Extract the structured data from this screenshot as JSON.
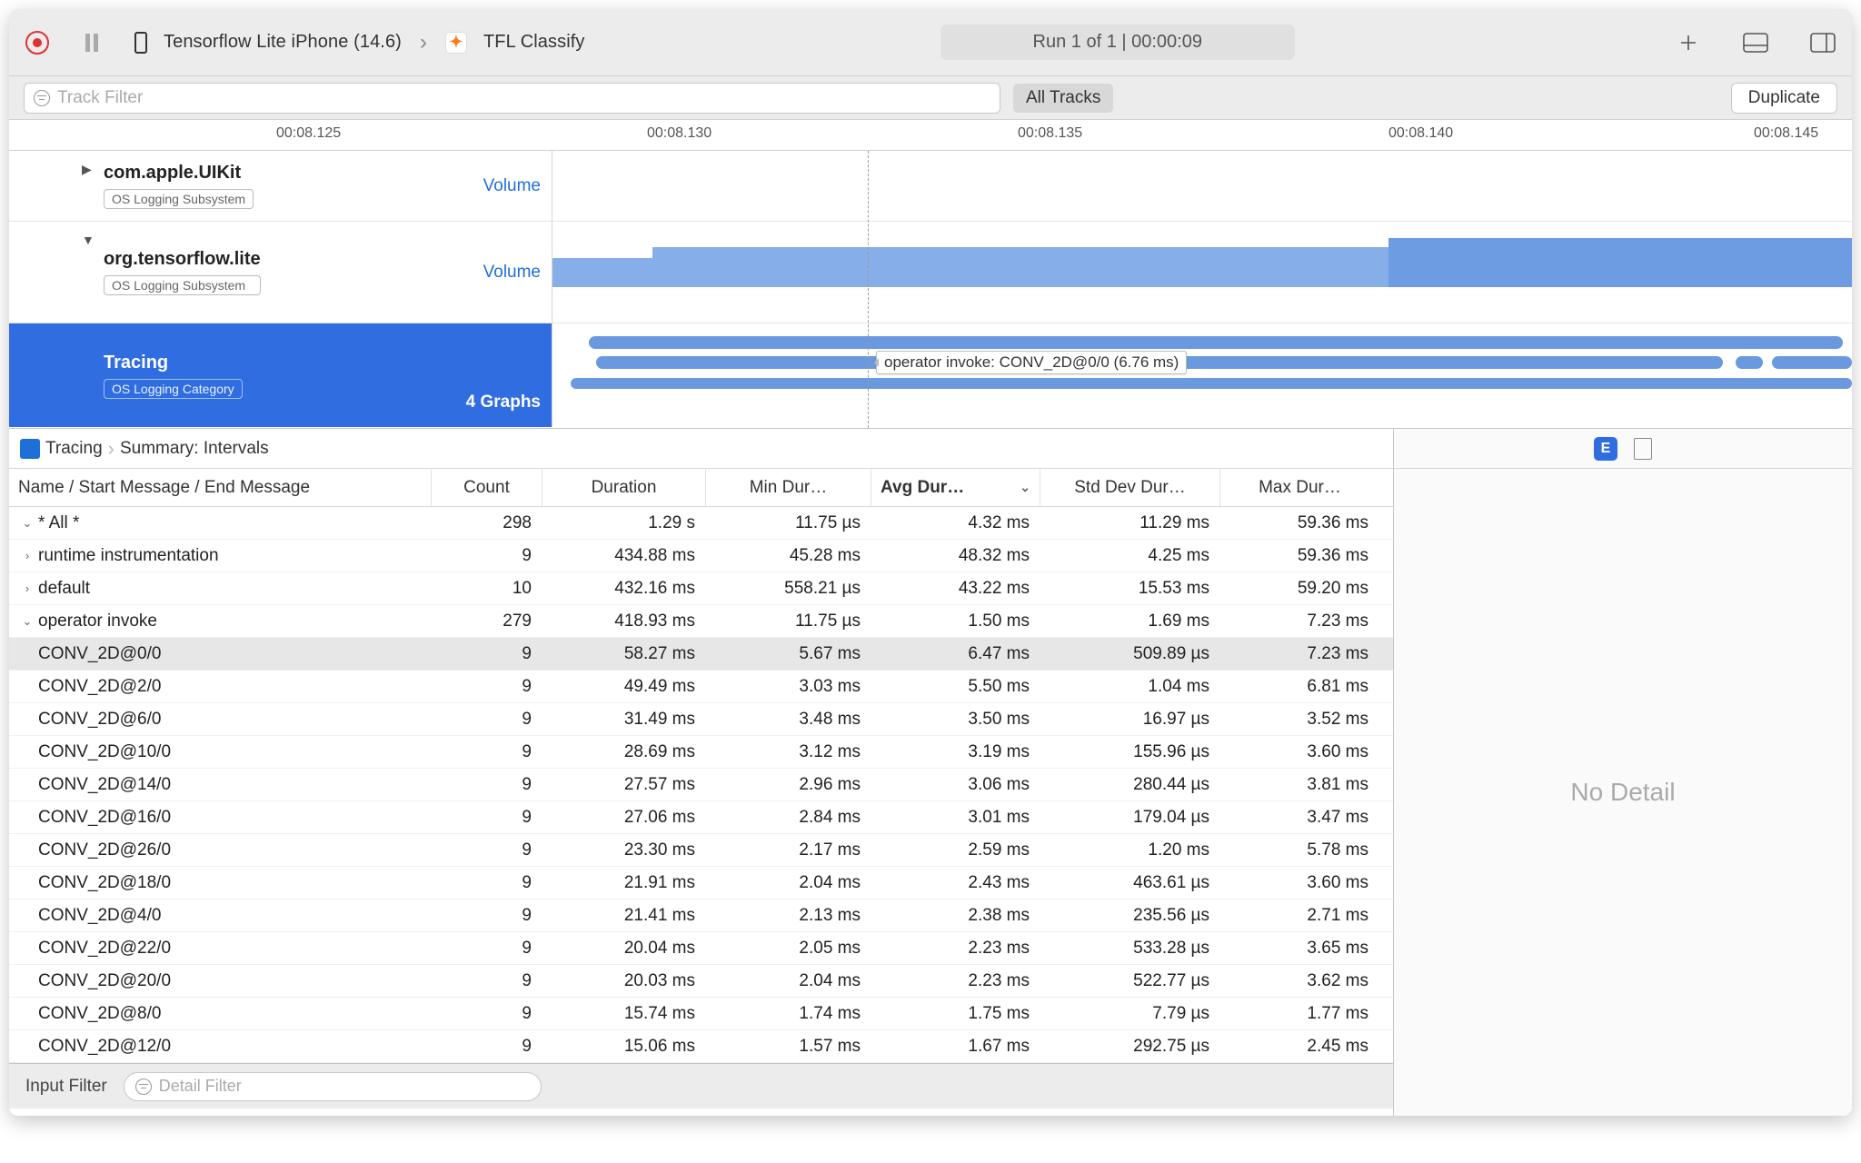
{
  "toolbar": {
    "device": "Tensorflow Lite iPhone (14.6)",
    "app": "TFL Classify",
    "run_status": "Run 1 of 1  |  00:00:09"
  },
  "filterbar": {
    "track_placeholder": "Track Filter",
    "all_tracks": "All Tracks",
    "duplicate": "Duplicate"
  },
  "ruler": {
    "ticks": [
      "00:08.125",
      "00:08.130",
      "00:08.135",
      "00:08.140",
      "00:08.145"
    ]
  },
  "tracks": {
    "uikit": {
      "title": "com.apple.UIKit",
      "subtitle": "OS Logging Subsystem",
      "mode": "Volume"
    },
    "tflite": {
      "title": "org.tensorflow.lite",
      "subtitle": "OS Logging Subsystem",
      "mode": "Volume"
    },
    "tracing": {
      "title": "Tracing",
      "subtitle": "OS Logging Category",
      "graphs": "4 Graphs",
      "tooltip": "operator invoke: CONV_2D@0/0 (6.76 ms)"
    }
  },
  "crumbs": {
    "a": "Tracing",
    "b": "Summary: Intervals"
  },
  "columns": {
    "name": "Name / Start Message / End Message",
    "count": "Count",
    "dur": "Duration",
    "min": "Min Dur…",
    "avg": "Avg Dur…",
    "std": "Std Dev Dur…",
    "max": "Max Dur…"
  },
  "rows": [
    {
      "indent": 0,
      "disc": "v",
      "name": "* All *",
      "count": "298",
      "dur": "1.29 s",
      "min": "11.75 µs",
      "avg": "4.32 ms",
      "std": "11.29 ms",
      "max": "59.36 ms",
      "sel": false
    },
    {
      "indent": 1,
      "disc": ">",
      "name": "runtime instrumentation",
      "count": "9",
      "dur": "434.88 ms",
      "min": "45.28 ms",
      "avg": "48.32 ms",
      "std": "4.25 ms",
      "max": "59.36 ms",
      "sel": false
    },
    {
      "indent": 1,
      "disc": ">",
      "name": "default",
      "count": "10",
      "dur": "432.16 ms",
      "min": "558.21 µs",
      "avg": "43.22 ms",
      "std": "15.53 ms",
      "max": "59.20 ms",
      "sel": false
    },
    {
      "indent": 1,
      "disc": "v",
      "name": "operator invoke",
      "count": "279",
      "dur": "418.93 ms",
      "min": "11.75 µs",
      "avg": "1.50 ms",
      "std": "1.69 ms",
      "max": "7.23 ms",
      "sel": false
    },
    {
      "indent": 2,
      "disc": "",
      "name": "CONV_2D@0/0",
      "count": "9",
      "dur": "58.27 ms",
      "min": "5.67 ms",
      "avg": "6.47 ms",
      "std": "509.89 µs",
      "max": "7.23 ms",
      "sel": true
    },
    {
      "indent": 2,
      "disc": "",
      "name": "CONV_2D@2/0",
      "count": "9",
      "dur": "49.49 ms",
      "min": "3.03 ms",
      "avg": "5.50 ms",
      "std": "1.04 ms",
      "max": "6.81 ms",
      "sel": false
    },
    {
      "indent": 2,
      "disc": "",
      "name": "CONV_2D@6/0",
      "count": "9",
      "dur": "31.49 ms",
      "min": "3.48 ms",
      "avg": "3.50 ms",
      "std": "16.97 µs",
      "max": "3.52 ms",
      "sel": false
    },
    {
      "indent": 2,
      "disc": "",
      "name": "CONV_2D@10/0",
      "count": "9",
      "dur": "28.69 ms",
      "min": "3.12 ms",
      "avg": "3.19 ms",
      "std": "155.96 µs",
      "max": "3.60 ms",
      "sel": false
    },
    {
      "indent": 2,
      "disc": "",
      "name": "CONV_2D@14/0",
      "count": "9",
      "dur": "27.57 ms",
      "min": "2.96 ms",
      "avg": "3.06 ms",
      "std": "280.44 µs",
      "max": "3.81 ms",
      "sel": false
    },
    {
      "indent": 2,
      "disc": "",
      "name": "CONV_2D@16/0",
      "count": "9",
      "dur": "27.06 ms",
      "min": "2.84 ms",
      "avg": "3.01 ms",
      "std": "179.04 µs",
      "max": "3.47 ms",
      "sel": false
    },
    {
      "indent": 2,
      "disc": "",
      "name": "CONV_2D@26/0",
      "count": "9",
      "dur": "23.30 ms",
      "min": "2.17 ms",
      "avg": "2.59 ms",
      "std": "1.20 ms",
      "max": "5.78 ms",
      "sel": false
    },
    {
      "indent": 2,
      "disc": "",
      "name": "CONV_2D@18/0",
      "count": "9",
      "dur": "21.91 ms",
      "min": "2.04 ms",
      "avg": "2.43 ms",
      "std": "463.61 µs",
      "max": "3.60 ms",
      "sel": false
    },
    {
      "indent": 2,
      "disc": "",
      "name": "CONV_2D@4/0",
      "count": "9",
      "dur": "21.41 ms",
      "min": "2.13 ms",
      "avg": "2.38 ms",
      "std": "235.56 µs",
      "max": "2.71 ms",
      "sel": false
    },
    {
      "indent": 2,
      "disc": "",
      "name": "CONV_2D@22/0",
      "count": "9",
      "dur": "20.04 ms",
      "min": "2.05 ms",
      "avg": "2.23 ms",
      "std": "533.28 µs",
      "max": "3.65 ms",
      "sel": false
    },
    {
      "indent": 2,
      "disc": "",
      "name": "CONV_2D@20/0",
      "count": "9",
      "dur": "20.03 ms",
      "min": "2.04 ms",
      "avg": "2.23 ms",
      "std": "522.77 µs",
      "max": "3.62 ms",
      "sel": false
    },
    {
      "indent": 2,
      "disc": "",
      "name": "CONV_2D@8/0",
      "count": "9",
      "dur": "15.74 ms",
      "min": "1.74 ms",
      "avg": "1.75 ms",
      "std": "7.79 µs",
      "max": "1.77 ms",
      "sel": false
    },
    {
      "indent": 2,
      "disc": "",
      "name": "CONV_2D@12/0",
      "count": "9",
      "dur": "15.06 ms",
      "min": "1.57 ms",
      "avg": "1.67 ms",
      "std": "292.75 µs",
      "max": "2.45 ms",
      "sel": false
    }
  ],
  "bottom": {
    "input_filter": "Input Filter",
    "detail_placeholder": "Detail Filter"
  },
  "right": {
    "no_detail": "No Detail",
    "badge": "E"
  }
}
